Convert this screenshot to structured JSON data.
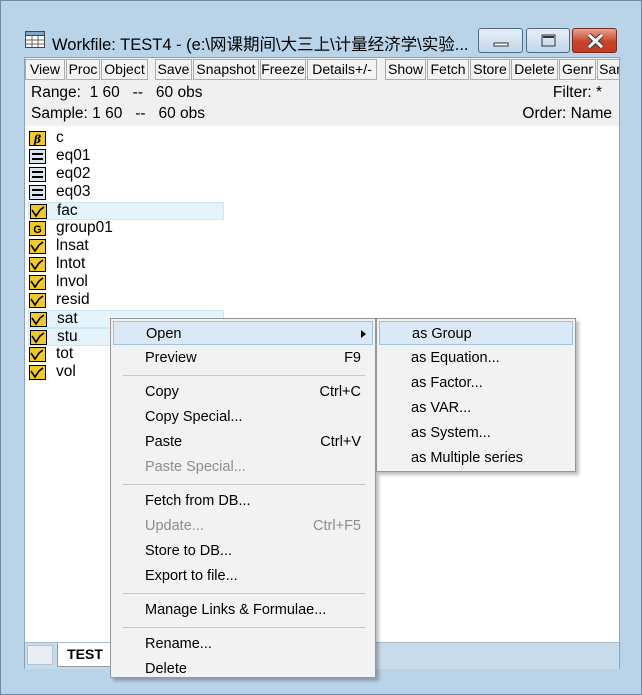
{
  "window": {
    "title": "Workfile: TEST4 - (e:\\网课期间\\大三上\\计量经济学\\实验..."
  },
  "toolbar": [
    "View",
    "Proc",
    "Object",
    "Save",
    "Snapshot",
    "Freeze",
    "Details+/-",
    "Show",
    "Fetch",
    "Store",
    "Delete",
    "Genr",
    "Sar"
  ],
  "info": {
    "range": "Range:  1 60   --   60 obs",
    "sample": "Sample: 1 60   --   60 obs",
    "filter": "Filter: *",
    "order": "Order: Name"
  },
  "objects": [
    {
      "name": "c",
      "icon": "coefficient-icon",
      "selected": false
    },
    {
      "name": "eq01",
      "icon": "equation-icon",
      "selected": false
    },
    {
      "name": "eq02",
      "icon": "equation-icon",
      "selected": false
    },
    {
      "name": "eq03",
      "icon": "equation-icon",
      "selected": false
    },
    {
      "name": "fac",
      "icon": "series-icon",
      "selected": true
    },
    {
      "name": "group01",
      "icon": "group-icon",
      "selected": false
    },
    {
      "name": "lnsat",
      "icon": "series-icon",
      "selected": false
    },
    {
      "name": "lntot",
      "icon": "series-icon",
      "selected": false
    },
    {
      "name": "lnvol",
      "icon": "series-icon",
      "selected": false
    },
    {
      "name": "resid",
      "icon": "series-icon",
      "selected": false
    },
    {
      "name": "sat",
      "icon": "series-icon",
      "selected": true
    },
    {
      "name": "stu",
      "icon": "series-icon",
      "selected": true
    },
    {
      "name": "tot",
      "icon": "series-icon",
      "selected": false
    },
    {
      "name": "vol",
      "icon": "series-icon",
      "selected": false
    }
  ],
  "tab": "TEST",
  "context_menu": {
    "groups": [
      [
        {
          "label": "Open",
          "shortcut": "",
          "submenu": true,
          "disabled": false,
          "highlighted": true
        },
        {
          "label": "Preview",
          "shortcut": "F9",
          "disabled": false
        }
      ],
      [
        {
          "label": "Copy",
          "shortcut": "Ctrl+C",
          "disabled": false
        },
        {
          "label": "Copy Special...",
          "shortcut": "",
          "disabled": false
        },
        {
          "label": "Paste",
          "shortcut": "Ctrl+V",
          "disabled": false
        },
        {
          "label": "Paste Special...",
          "shortcut": "",
          "disabled": true
        }
      ],
      [
        {
          "label": "Fetch from DB...",
          "shortcut": "",
          "disabled": false
        },
        {
          "label": "Update...",
          "shortcut": "Ctrl+F5",
          "disabled": true
        },
        {
          "label": "Store to DB...",
          "shortcut": "",
          "disabled": false
        },
        {
          "label": "Export to file...",
          "shortcut": "",
          "disabled": false
        }
      ],
      [
        {
          "label": "Manage Links & Formulae...",
          "shortcut": "",
          "disabled": false
        }
      ],
      [
        {
          "label": "Rename...",
          "shortcut": "",
          "disabled": false
        },
        {
          "label": "Delete",
          "shortcut": "",
          "disabled": false
        }
      ]
    ]
  },
  "submenu": [
    "as Group",
    "as Equation...",
    "as Factor...",
    "as VAR...",
    "as System...",
    "as Multiple series"
  ],
  "colors": {
    "icon_fill": "#f0c92e",
    "selection": "#e5f3fb",
    "menu_highlight": "#dbe9f6"
  }
}
